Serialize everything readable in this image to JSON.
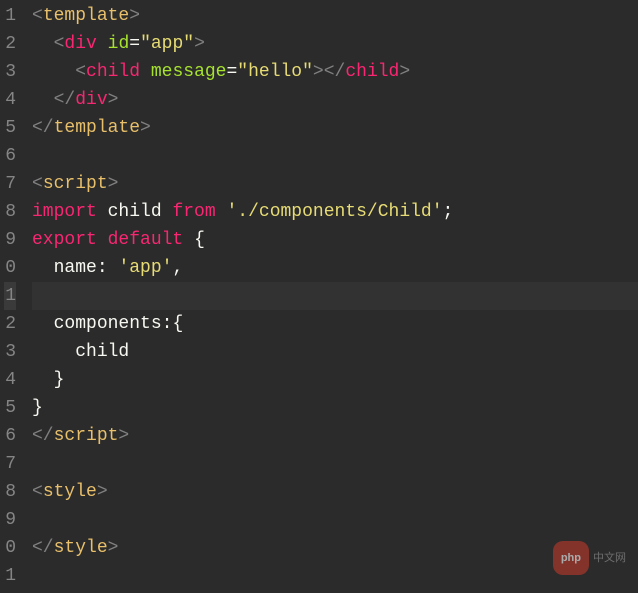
{
  "lines": [
    {
      "n": "1"
    },
    {
      "n": "2"
    },
    {
      "n": "3"
    },
    {
      "n": "4"
    },
    {
      "n": "5"
    },
    {
      "n": "6"
    },
    {
      "n": "7"
    },
    {
      "n": "8"
    },
    {
      "n": "9"
    },
    {
      "n": "0"
    },
    {
      "n": "1"
    },
    {
      "n": "2"
    },
    {
      "n": "3"
    },
    {
      "n": "4"
    },
    {
      "n": "5"
    },
    {
      "n": "6"
    },
    {
      "n": "7"
    },
    {
      "n": "8"
    },
    {
      "n": "9"
    },
    {
      "n": "0"
    },
    {
      "n": "1"
    }
  ],
  "code": {
    "l1": {
      "open": "<",
      "tag": "template",
      "close": ">"
    },
    "l2": {
      "indent": "  ",
      "open": "<",
      "tag": "div",
      "attr": "id",
      "eq": "=",
      "val": "\"app\"",
      "close": ">"
    },
    "l3": {
      "indent": "    ",
      "open": "<",
      "tag": "child",
      "attr": "message",
      "eq": "=",
      "val": "\"hello\"",
      "close": ">",
      "open2": "</",
      "tag2": "child",
      "close2": ">"
    },
    "l4": {
      "indent": "  ",
      "open": "</",
      "tag": "div",
      "close": ">"
    },
    "l5": {
      "open": "</",
      "tag": "template",
      "close": ">"
    },
    "l7": {
      "open": "<",
      "tag": "script",
      "close": ">"
    },
    "l8": {
      "import": "import",
      "sp1": " ",
      "child": "child",
      "sp2": " ",
      "from": "from",
      "sp3": " ",
      "path": "'./components/Child'",
      "semi": ";"
    },
    "l9": {
      "export": "export",
      "sp1": " ",
      "default": "default",
      "sp2": " ",
      "brace": "{"
    },
    "l10": {
      "indent": "  ",
      "key": "name",
      "colon": ": ",
      "val": "'app'",
      "comma": ","
    },
    "l12": {
      "indent": "  ",
      "key": "components",
      "colon": ":",
      "brace": "{"
    },
    "l13": {
      "indent": "    ",
      "val": "child"
    },
    "l14": {
      "indent": "  ",
      "brace": "}"
    },
    "l15": {
      "brace": "}"
    },
    "l16": {
      "open": "</",
      "tag": "script",
      "close": ">"
    },
    "l18": {
      "open": "<",
      "tag": "style",
      "close": ">"
    },
    "l20": {
      "open": "</",
      "tag": "style",
      "close": ">"
    }
  },
  "watermark": {
    "badge": "php",
    "text": "中文网"
  }
}
